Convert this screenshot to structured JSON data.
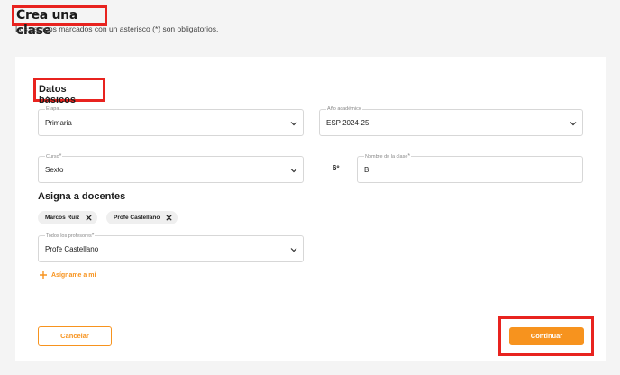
{
  "page": {
    "title": "Crea una clase",
    "subtitle": "Los campos marcados con un asterisco (*) son obligatorios."
  },
  "basic": {
    "section_title": "Datos básicos",
    "etapa": {
      "label": "Etapa",
      "value": "Primaria"
    },
    "anio": {
      "label": "Año académico",
      "value": "ESP 2024-25"
    },
    "curso": {
      "label": "Curso",
      "required_mark": "*",
      "value": "Sexto"
    },
    "curso_indicator": "6º",
    "nombre": {
      "label": "Nombre de la clase",
      "required_mark": "*",
      "value": "B"
    }
  },
  "teachers": {
    "section_title": "Asigna a docentes",
    "chips": [
      {
        "label": "Marcos Ruiz"
      },
      {
        "label": "Profe Castellano"
      }
    ],
    "select": {
      "label": "Todos los profesores",
      "required_mark": "*",
      "value": "Profe Castellano"
    },
    "add_me_label": "Asígname a mí"
  },
  "actions": {
    "cancel_label": "Cancelar",
    "continue_label": "Continuar"
  },
  "colors": {
    "accent": "#f7931e",
    "highlight": "#e8231f",
    "card": "#ffffff",
    "background": "#f4f4f4"
  },
  "icons": {
    "chevron": "chevron-down-icon",
    "remove": "close-icon",
    "add": "plus-icon"
  }
}
